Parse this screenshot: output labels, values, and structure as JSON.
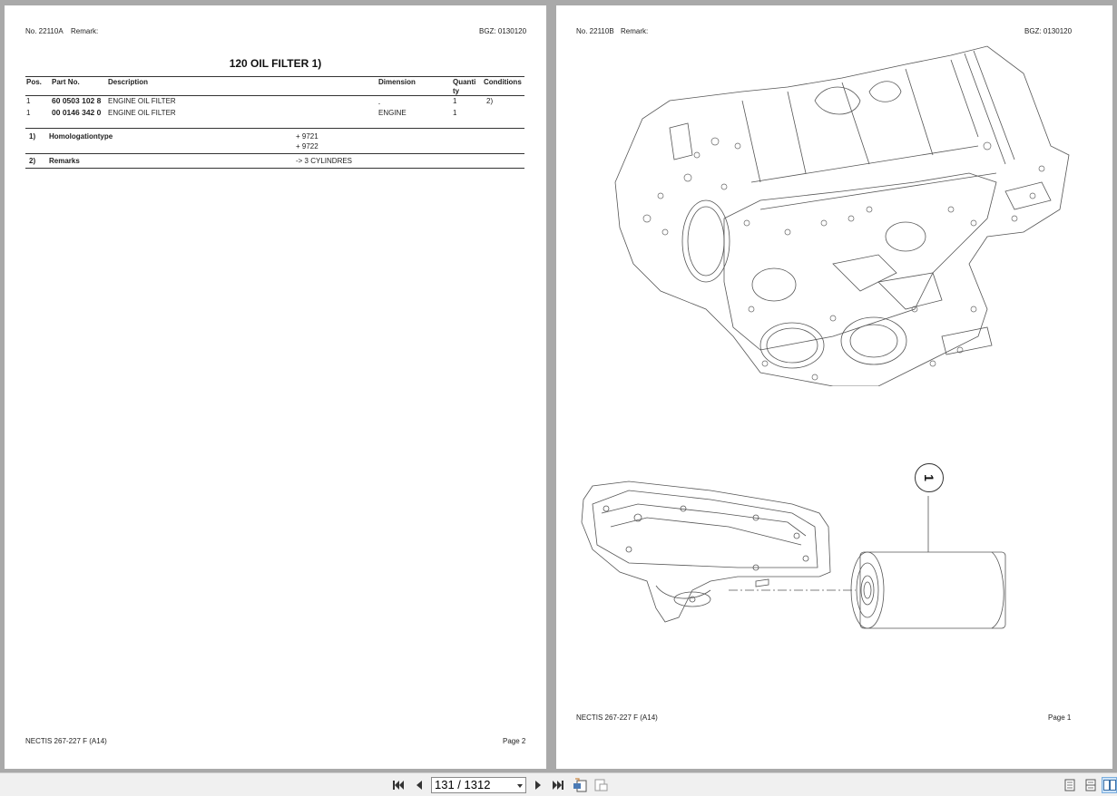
{
  "left_page": {
    "header_no": "No. 22110A",
    "header_remark": "Remark:",
    "header_bgz": "BGZ: 0130120",
    "title": "120 OIL FILTER  1)",
    "table": {
      "headers": [
        "Pos.",
        "Part No.",
        "Description",
        "Dimension",
        "Quanti",
        "ty",
        "Conditions"
      ],
      "rows": [
        {
          "pos": "1",
          "part": "60 0503 102 8",
          "desc": "ENGINE OIL FILTER",
          "dim": "",
          "qty": "1",
          "cond": "2)"
        },
        {
          "pos": "1",
          "part": "00 0146 342 0",
          "desc": "ENGINE OIL FILTER",
          "dim": "ENGINE",
          "qty": "1",
          "cond": ""
        }
      ]
    },
    "notes": [
      {
        "num": "1)",
        "label": "Homologationtype",
        "values": [
          "+ 9721",
          "+ 9722"
        ]
      },
      {
        "num": "2)",
        "label": "Remarks",
        "values": [
          "-> 3 CYLINDRES"
        ]
      }
    ],
    "footer_model": "NECTIS 267-227 F (A14)",
    "footer_page": "Page 2"
  },
  "right_page": {
    "header_no": "No. 22110B",
    "header_remark": "Remark:",
    "header_bgz": "BGZ: 0130120",
    "callout": "1",
    "footer_model": "NECTIS 267-227 F (A14)",
    "footer_page": "Page 1"
  },
  "toolbar": {
    "page_indicator": "131 / 1312",
    "icons": [
      "first-page-icon",
      "previous-page-icon",
      "next-page-icon",
      "last-page-icon",
      "rotate-icon",
      "export-icon",
      "single-page-view-icon",
      "continuous-view-icon",
      "two-page-view-icon"
    ]
  }
}
